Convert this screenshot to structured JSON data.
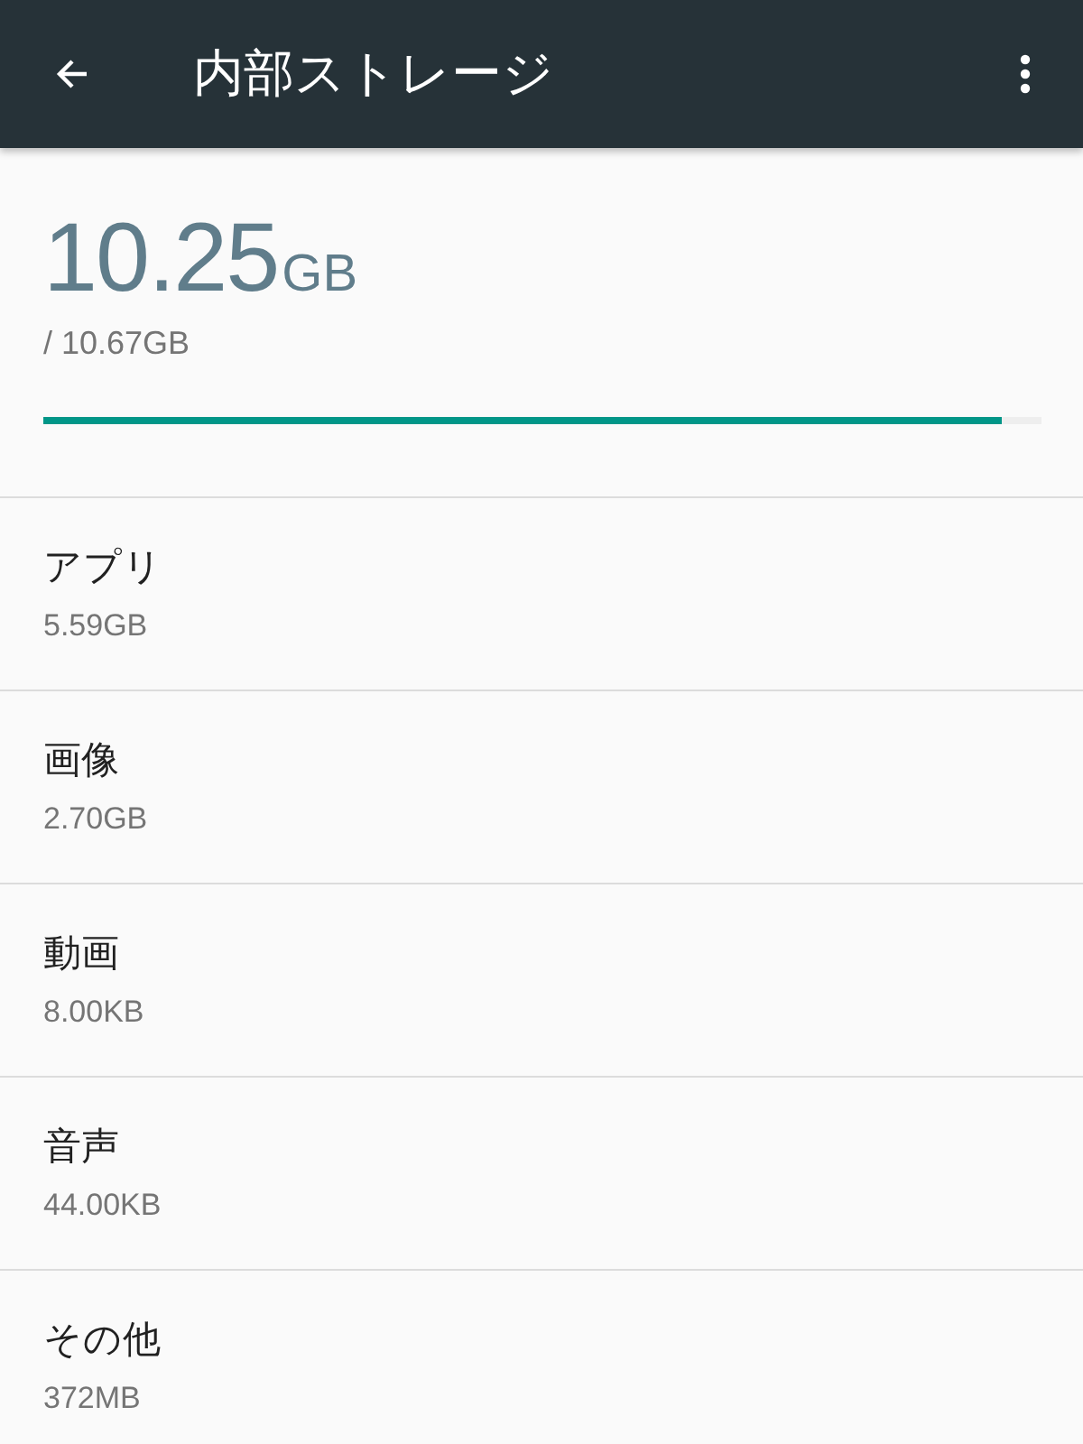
{
  "app_bar": {
    "title": "内部ストレージ"
  },
  "summary": {
    "used": "10.25",
    "used_unit": "GB",
    "total": "/ 10.67GB",
    "level": 0.96
  },
  "categories": [
    {
      "name": "アプリ",
      "size": "5.59GB"
    },
    {
      "name": "画像",
      "size": "2.70GB"
    },
    {
      "name": "動画",
      "size": "8.00KB"
    },
    {
      "name": "音声",
      "size": "44.00KB"
    },
    {
      "name": "その他",
      "size": "372MB"
    }
  ]
}
